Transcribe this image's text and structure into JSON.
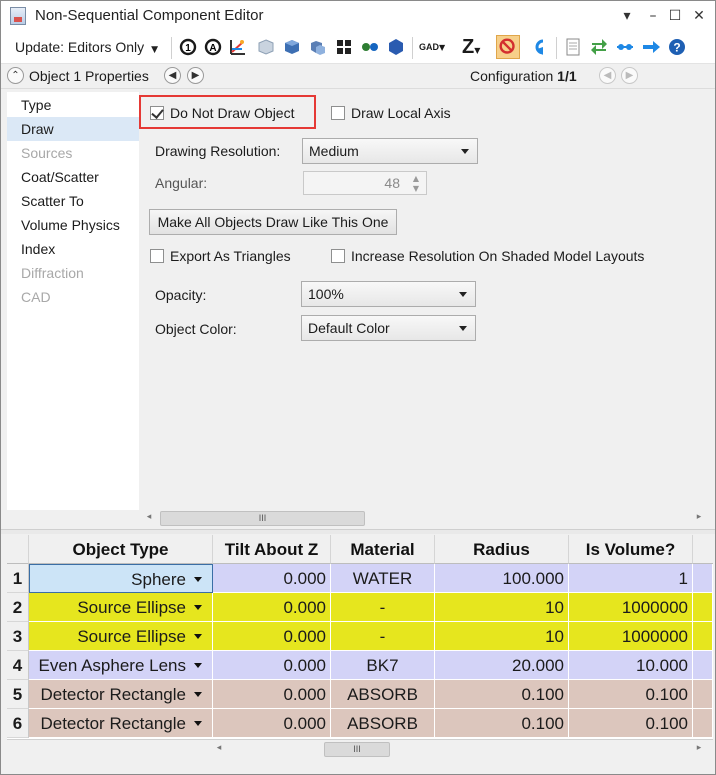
{
  "window": {
    "title": "Non-Sequential Component Editor",
    "controls": {
      "pin": "▾",
      "minimize": "–",
      "maximize": "☐",
      "close": "✕"
    }
  },
  "toolbar": {
    "update_label": "Update: Editors Only",
    "icons": [
      "refresh-icon",
      "refresh-all-icon",
      "ray-trace-icon",
      "cube-wire-icon",
      "cube-solid-icon",
      "cube-shaded-icon",
      "grid-icon",
      "dots-icon",
      "hexagon-icon",
      "gad-icon",
      "z-icon",
      "no-entry-icon",
      "undo-arrow-icon",
      "document-icon",
      "swap-icon",
      "link-icon",
      "arrow-right-icon",
      "help-icon"
    ],
    "gad_label": "GAD",
    "z_label": "Z"
  },
  "header": {
    "title": "Object 1 Properties",
    "config_prefix": "Configuration ",
    "config_value": "1/1"
  },
  "nav": {
    "items": [
      {
        "label": "Type",
        "state": "normal"
      },
      {
        "label": "Draw",
        "state": "selected"
      },
      {
        "label": "Sources",
        "state": "disabled"
      },
      {
        "label": "Coat/Scatter",
        "state": "normal"
      },
      {
        "label": "Scatter To",
        "state": "normal"
      },
      {
        "label": "Volume Physics",
        "state": "normal"
      },
      {
        "label": "Index",
        "state": "normal"
      },
      {
        "label": "Diffraction",
        "state": "disabled"
      },
      {
        "label": "CAD",
        "state": "disabled"
      }
    ]
  },
  "draw": {
    "do_not_draw_label": "Do Not Draw Object",
    "do_not_draw_checked": true,
    "draw_local_axis_label": "Draw Local Axis",
    "draw_local_axis_checked": false,
    "resolution_label": "Drawing Resolution:",
    "resolution_value": "Medium",
    "angular_label": "Angular:",
    "angular_value": "48",
    "make_all_label": "Make All Objects Draw Like This One",
    "export_triangles_label": "Export As Triangles",
    "export_triangles_checked": false,
    "increase_res_label": "Increase Resolution On Shaded Model Layouts",
    "increase_res_checked": false,
    "opacity_label": "Opacity:",
    "opacity_value": "100%",
    "color_label": "Object Color:",
    "color_value": "Default Color"
  },
  "grid": {
    "columns": [
      "Object Type",
      "Tilt About Z",
      "Material",
      "Radius",
      "Is Volume?"
    ],
    "rows": [
      {
        "num": "1",
        "type": "Sphere",
        "tilt": "0.000",
        "material": "WATER",
        "radius": "100.000",
        "volume": "1",
        "color": "#d3d3f7"
      },
      {
        "num": "2",
        "type": "Source Ellipse",
        "tilt": "0.000",
        "material": "-",
        "radius": "10",
        "volume": "1000000",
        "color": "#e6e61e"
      },
      {
        "num": "3",
        "type": "Source Ellipse",
        "tilt": "0.000",
        "material": "-",
        "radius": "10",
        "volume": "1000000",
        "color": "#e6e61e"
      },
      {
        "num": "4",
        "type": "Even Asphere Lens",
        "tilt": "0.000",
        "material": "BK7",
        "radius": "20.000",
        "volume": "10.000",
        "color": "#d3d3f7"
      },
      {
        "num": "5",
        "type": "Detector Rectangle",
        "tilt": "0.000",
        "material": "ABSORB",
        "radius": "0.100",
        "volume": "0.100",
        "color": "#dcc6bd"
      },
      {
        "num": "6",
        "type": "Detector Rectangle",
        "tilt": "0.000",
        "material": "ABSORB",
        "radius": "0.100",
        "volume": "0.100",
        "color": "#dcc6bd"
      }
    ]
  },
  "scroll": {
    "thumb_grip": "III",
    "left_arrow": "◂",
    "right_arrow": "▸"
  }
}
